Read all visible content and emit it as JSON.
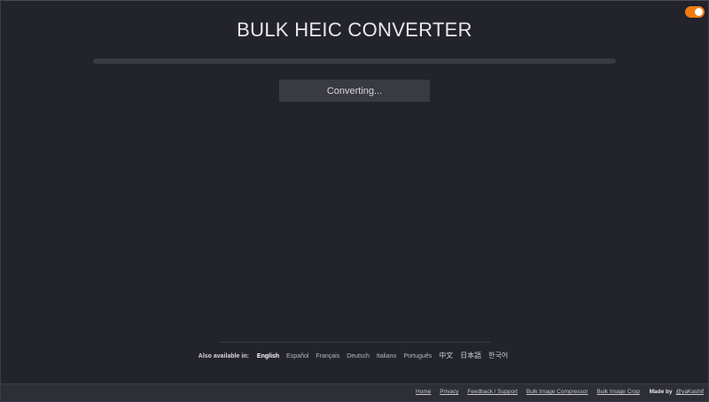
{
  "header": {
    "title": "BULK HEIC CONVERTER"
  },
  "theme_toggle": {
    "state": "on",
    "accent_color": "#f07a12"
  },
  "progress": {
    "fraction": 0
  },
  "convert_button": {
    "label": "Converting..."
  },
  "languages": {
    "lead": "Also available in:",
    "items": [
      {
        "label": "English",
        "active": true
      },
      {
        "label": "Español",
        "active": false
      },
      {
        "label": "Français",
        "active": false
      },
      {
        "label": "Deutsch",
        "active": false
      },
      {
        "label": "Italiano",
        "active": false
      },
      {
        "label": "Português",
        "active": false
      },
      {
        "label": "中文",
        "active": false
      },
      {
        "label": "日本語",
        "active": false
      },
      {
        "label": "한국어",
        "active": false
      }
    ]
  },
  "footer": {
    "links": [
      "Home",
      "Privacy",
      "Feedback / Support",
      "Bulk Image Compressor",
      "Bulk Image Crop"
    ],
    "made_by": "Made by",
    "handle": "@yaKashif"
  }
}
